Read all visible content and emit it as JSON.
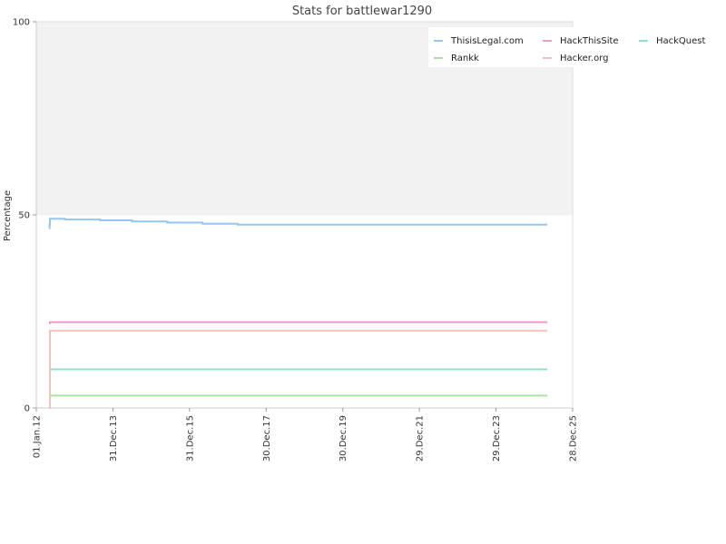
{
  "chart_data": {
    "type": "line",
    "title": "Stats for battlewar1290",
    "xlabel": "",
    "ylabel": "Percentage",
    "ylim": [
      0,
      100
    ],
    "yticks": [
      0,
      50,
      100
    ],
    "x_range": [
      "2012-01-01",
      "2025-12-28"
    ],
    "x_ticks": [
      {
        "date": "2012-01-01",
        "label": "01.Jan.12"
      },
      {
        "date": "2013-12-31",
        "label": "31.Dec.13"
      },
      {
        "date": "2015-12-31",
        "label": "31.Dec.15"
      },
      {
        "date": "2017-12-30",
        "label": "30.Dec.17"
      },
      {
        "date": "2019-12-30",
        "label": "30.Dec.19"
      },
      {
        "date": "2021-12-29",
        "label": "29.Dec.21"
      },
      {
        "date": "2023-12-29",
        "label": "29.Dec.23"
      },
      {
        "date": "2025-12-28",
        "label": "28.Dec.25"
      }
    ],
    "upper_band": {
      "from": 50,
      "to": 100,
      "color": "#f2f2f2"
    },
    "grid": false,
    "legend": {
      "position": "top-right"
    },
    "series": [
      {
        "name": "ThisisLegal.com",
        "color": "#94c6ee",
        "points": [
          [
            "2012-05-01",
            46.5
          ],
          [
            "2012-05-06",
            47.5
          ],
          [
            "2012-05-10",
            49.0
          ],
          [
            "2012-10-01",
            48.8
          ],
          [
            "2013-09-01",
            48.6
          ],
          [
            "2014-07-01",
            48.3
          ],
          [
            "2015-06-01",
            48.0
          ],
          [
            "2016-05-01",
            47.7
          ],
          [
            "2017-04-01",
            47.5
          ],
          [
            "2025-05-01",
            47.5
          ]
        ]
      },
      {
        "name": "HackThisSite",
        "color": "#ee99cc",
        "points": [
          [
            "2012-05-01",
            22.0
          ],
          [
            "2012-05-10",
            22.2
          ],
          [
            "2025-05-01",
            22.2
          ]
        ]
      },
      {
        "name": "HackQuest",
        "color": "#8fe0cc",
        "points": [
          [
            "2012-05-01",
            4.5
          ],
          [
            "2012-05-10",
            10.0
          ],
          [
            "2025-05-01",
            10.0
          ]
        ]
      },
      {
        "name": "Rankk",
        "color": "#a8e6a0",
        "points": [
          [
            "2012-05-01",
            3.2
          ],
          [
            "2025-05-01",
            3.2
          ]
        ]
      },
      {
        "name": "Hacker.org",
        "color": "#f5c0c0",
        "points": [
          [
            "2012-05-01",
            0.0
          ],
          [
            "2012-05-10",
            20.0
          ],
          [
            "2025-05-01",
            20.0
          ]
        ]
      }
    ]
  }
}
